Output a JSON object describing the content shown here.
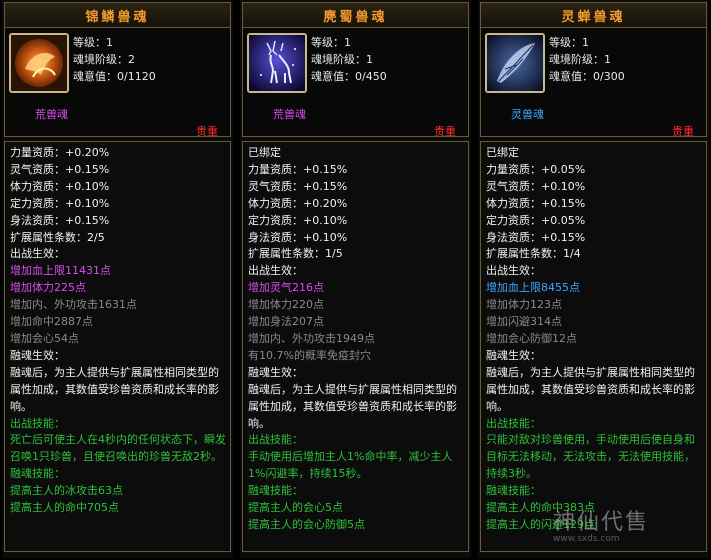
{
  "panels": [
    {
      "title": "锦鳞兽魂",
      "icon": "koi-fish-icon",
      "stats": [
        "等级：1",
        "魂境阶级：2",
        "魂意值：0/1120"
      ],
      "kind": "荒兽魂",
      "kind_color": "#d94cf0",
      "valuable": "贵重",
      "lines": [
        {
          "t": "力量资质：+0.20%",
          "c": "w"
        },
        {
          "t": "灵气资质：+0.15%",
          "c": "w"
        },
        {
          "t": "体力资质：+0.10%",
          "c": "w"
        },
        {
          "t": "定力资质：+0.10%",
          "c": "w"
        },
        {
          "t": "身法资质：+0.15%",
          "c": "w"
        },
        {
          "t": "扩展属性条数：2/5",
          "c": "w"
        },
        {
          "t": "出战生效：",
          "c": "w"
        },
        {
          "t": "增加血上限11431点",
          "c": "purple"
        },
        {
          "t": "增加体力225点",
          "c": "purple"
        },
        {
          "t": "增加内、外功攻击1631点",
          "c": "gray"
        },
        {
          "t": "增加命中2887点",
          "c": "gray"
        },
        {
          "t": "增加会心54点",
          "c": "gray"
        },
        {
          "t": "融魂生效：",
          "c": "w"
        },
        {
          "t": "融魂后，为主人提供与扩展属性相同类型的属性加成，其数值受珍兽资质和成长率的影响。",
          "c": "w",
          "wrap": true
        },
        {
          "t": "出战技能：",
          "c": "green"
        },
        {
          "t": "死亡后可使主人在4秒内的任何状态下，瞬发召唤1只珍兽，且使召唤出的珍兽无敌2秒。",
          "c": "green",
          "wrap": true
        },
        {
          "t": "融魂技能：",
          "c": "green"
        },
        {
          "t": "提高主人的冰攻击63点",
          "c": "green"
        },
        {
          "t": "提高主人的命中705点",
          "c": "green"
        }
      ]
    },
    {
      "title": "麂蜀兽魂",
      "icon": "deer-icon",
      "stats": [
        "等级：1",
        "魂境阶级：1",
        "魂意值：0/450"
      ],
      "kind": "荒兽魂",
      "kind_color": "#d94cf0",
      "valuable": "贵重",
      "lines": [
        {
          "t": "已绑定",
          "c": "w"
        },
        {
          "t": "力量资质：+0.15%",
          "c": "w"
        },
        {
          "t": "灵气资质：+0.15%",
          "c": "w"
        },
        {
          "t": "体力资质：+0.20%",
          "c": "w"
        },
        {
          "t": "定力资质：+0.10%",
          "c": "w"
        },
        {
          "t": "身法资质：+0.10%",
          "c": "w"
        },
        {
          "t": "扩展属性条数：1/5",
          "c": "w"
        },
        {
          "t": "出战生效：",
          "c": "w"
        },
        {
          "t": "增加灵气216点",
          "c": "purple"
        },
        {
          "t": "增加体力220点",
          "c": "gray"
        },
        {
          "t": "增加身法207点",
          "c": "gray"
        },
        {
          "t": "增加内、外功攻击1949点",
          "c": "gray"
        },
        {
          "t": "有10.7%的概率免疫封穴",
          "c": "gray"
        },
        {
          "t": "融魂生效：",
          "c": "w"
        },
        {
          "t": "融魂后，为主人提供与扩展属性相同类型的属性加成，其数值受珍兽资质和成长率的影响。",
          "c": "w",
          "wrap": true
        },
        {
          "t": "出战技能：",
          "c": "green"
        },
        {
          "t": "手动使用后增加主人1%命中率，减少主人1%闪避率，持续15秒。",
          "c": "green",
          "wrap": true
        },
        {
          "t": "融魂技能：",
          "c": "green"
        },
        {
          "t": "提高主人的会心5点",
          "c": "green"
        },
        {
          "t": "提高主人的会心防御5点",
          "c": "green"
        }
      ]
    },
    {
      "title": "灵蝉兽魂",
      "icon": "cicada-wing-icon",
      "stats": [
        "等级：1",
        "魂境阶级：1",
        "魂意值：0/300"
      ],
      "kind": "灵兽魂",
      "kind_color": "#3aa7ff",
      "valuable": "贵重",
      "lines": [
        {
          "t": "已绑定",
          "c": "w"
        },
        {
          "t": "力量资质：+0.05%",
          "c": "w"
        },
        {
          "t": "灵气资质：+0.10%",
          "c": "w"
        },
        {
          "t": "体力资质：+0.15%",
          "c": "w"
        },
        {
          "t": "定力资质：+0.05%",
          "c": "w"
        },
        {
          "t": "身法资质：+0.15%",
          "c": "w"
        },
        {
          "t": "扩展属性条数：1/4",
          "c": "w"
        },
        {
          "t": "出战生效：",
          "c": "w"
        },
        {
          "t": "增加血上限8455点",
          "c": "blue"
        },
        {
          "t": "增加体力123点",
          "c": "gray"
        },
        {
          "t": "增加闪避314点",
          "c": "gray"
        },
        {
          "t": "增加会心防御12点",
          "c": "gray"
        },
        {
          "t": "融魂生效：",
          "c": "w"
        },
        {
          "t": "融魂后，为主人提供与扩展属性相同类型的属性加成，其数值受珍兽资质和成长率的影响。",
          "c": "w",
          "wrap": true
        },
        {
          "t": "出战技能：",
          "c": "green"
        },
        {
          "t": "只能对敌对珍兽使用，手动使用后使自身和目标无法移动，无法攻击，无法使用技能，持续3秒。",
          "c": "green",
          "wrap": true
        },
        {
          "t": "融魂技能：",
          "c": "green"
        },
        {
          "t": "提高主人的命中383点",
          "c": "green"
        },
        {
          "t": "提高主人的闪避129点",
          "c": "green"
        }
      ]
    }
  ],
  "watermark": {
    "logo": "神仙代售",
    "url": "www.sxds.com"
  }
}
